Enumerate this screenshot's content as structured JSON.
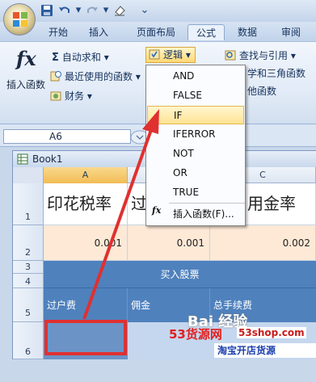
{
  "quick_access": {
    "dropdown_glyph": "▾",
    "menu_glyph": "⌄"
  },
  "tabs": [
    {
      "label": "开始"
    },
    {
      "label": "插入"
    },
    {
      "label": "页面布局"
    },
    {
      "label": "公式"
    },
    {
      "label": "数据"
    },
    {
      "label": "审阅"
    }
  ],
  "ribbon": {
    "insert_function": "插入函数",
    "fx_glyph": "fx",
    "autosum": "自动求和",
    "recent": "最近使用的函数",
    "financial": "财务",
    "logical": "逻辑",
    "lookup": "查找与引用",
    "math_partial": "学和三角函数",
    "other_partial": "他函数",
    "caret": "▾"
  },
  "logical_menu": {
    "items": [
      "AND",
      "FALSE",
      "IF",
      "IFERROR",
      "NOT",
      "OR",
      "TRUE"
    ],
    "highlighted": "IF",
    "insert_function": "插入函数(F)..."
  },
  "formula_bar": {
    "name_box": "A6"
  },
  "workbook": {
    "title": "Book1",
    "columns": [
      "A",
      "B",
      "C"
    ],
    "rows": [
      "1",
      "2",
      "3",
      "4",
      "5",
      "6"
    ],
    "r1": {
      "a": "印花税率",
      "b": "过",
      "c": "用金率"
    },
    "r2": {
      "a": "0.001",
      "b": "0.001",
      "c": "0.002"
    },
    "r3": {
      "merged": "买入股票"
    },
    "r5": {
      "a": "过户费",
      "b": "佣金",
      "c": "总手续费"
    }
  },
  "watermarks": {
    "baidu": "Bai 经验",
    "site_brand": "53货源网",
    "site_url": "53shop.com",
    "site_tagline": "淘宝开店货源"
  },
  "colors": {
    "accent_arrow": "#e03030",
    "selection_box": "#e03030",
    "header_blue": "#4f81bd",
    "menu_highlight": "#ffe394"
  }
}
